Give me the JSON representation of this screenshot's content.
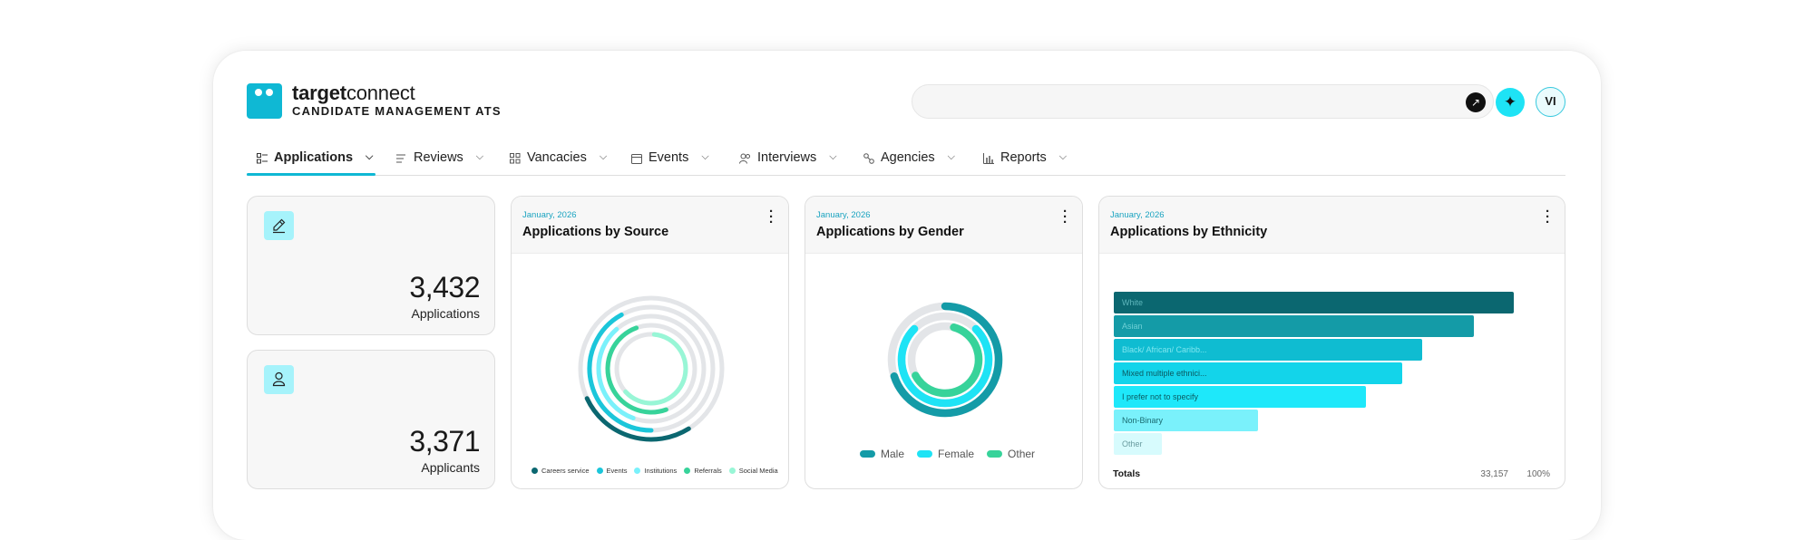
{
  "brand": {
    "name_bold": "target",
    "name_light": "connect",
    "subtitle": "CANDIDATE MANAGEMENT ATS"
  },
  "header": {
    "search_placeholder": "",
    "avatar_initials": "VI"
  },
  "nav": {
    "tabs": [
      {
        "label": "Applications",
        "icon": "list-icon",
        "active": true
      },
      {
        "label": "Reviews",
        "icon": "lines-icon"
      },
      {
        "label": "Vancacies",
        "icon": "grid-icon"
      },
      {
        "label": "Events",
        "icon": "calendar-icon"
      },
      {
        "label": "Interviews",
        "icon": "people-icon"
      },
      {
        "label": "Agencies",
        "icon": "link-icon"
      },
      {
        "label": "Reports",
        "icon": "bar-chart-icon"
      }
    ]
  },
  "kpis": [
    {
      "value": "3,432",
      "label": "Applications",
      "icon": "pencil-icon"
    },
    {
      "value": "3,371",
      "label": "Applicants",
      "icon": "person-icon"
    }
  ],
  "panels": {
    "source": {
      "date": "January, 2026",
      "title": "Applications by Source"
    },
    "gender": {
      "date": "January, 2026",
      "title": "Applications by Gender"
    },
    "ethnicity": {
      "date": "January, 2026",
      "title": "Applications by Ethnicity"
    }
  },
  "colors": {
    "accent": "#0fb8d4",
    "dark_teal": "#0b6770",
    "teal": "#149ba7",
    "cyan": "#1bc6da",
    "light_cyan": "#7af1fb",
    "mint": "#37d39a",
    "pale_mint": "#98f6d6",
    "track": "#e3e5e8"
  },
  "chart_data": [
    {
      "type": "radial",
      "title": "Applications by Source",
      "categories": [
        "Careers service",
        "Events",
        "Institutions",
        "Referrals",
        "Social Media"
      ],
      "values": [
        0.27,
        0.42,
        0.33,
        0.5,
        0.62
      ],
      "colors": [
        "#0b6770",
        "#1bc6da",
        "#7af1fb",
        "#37d39a",
        "#98f6d6"
      ],
      "value_unit": "fraction of full ring"
    },
    {
      "type": "radial",
      "title": "Applications by Gender",
      "categories": [
        "Male",
        "Female",
        "Other"
      ],
      "values": [
        0.7,
        0.75,
        0.63
      ],
      "colors": [
        "#149ba7",
        "#1ee3f5",
        "#37d39a"
      ],
      "value_unit": "fraction of full ring"
    },
    {
      "type": "bar",
      "orientation": "horizontal",
      "title": "Applications by Ethnicity",
      "categories": [
        "White",
        "Asian",
        "Black/ African/ Caribb...",
        "Mixed multiple ethnici...",
        "I prefer not to specify",
        "Non-Binary",
        "Other"
      ],
      "values": [
        100,
        90,
        77,
        72,
        63,
        36,
        12
      ],
      "value_unit": "relative bar length (%)",
      "colors": [
        "#0b6770",
        "#149ba7",
        "#0fbcd1",
        "#13d4ea",
        "#1ee8fa",
        "#7af1fb",
        "#d7fbfd"
      ],
      "label_colors": [
        "#5fb7bd",
        "#6fd0d6",
        "#7ee6ef",
        "#0b5a61",
        "#0b5a61",
        "#1a6a70",
        "#6a9ca0"
      ],
      "totals": {
        "label": "Totals",
        "count": "33,157",
        "percent": "100%"
      }
    }
  ]
}
